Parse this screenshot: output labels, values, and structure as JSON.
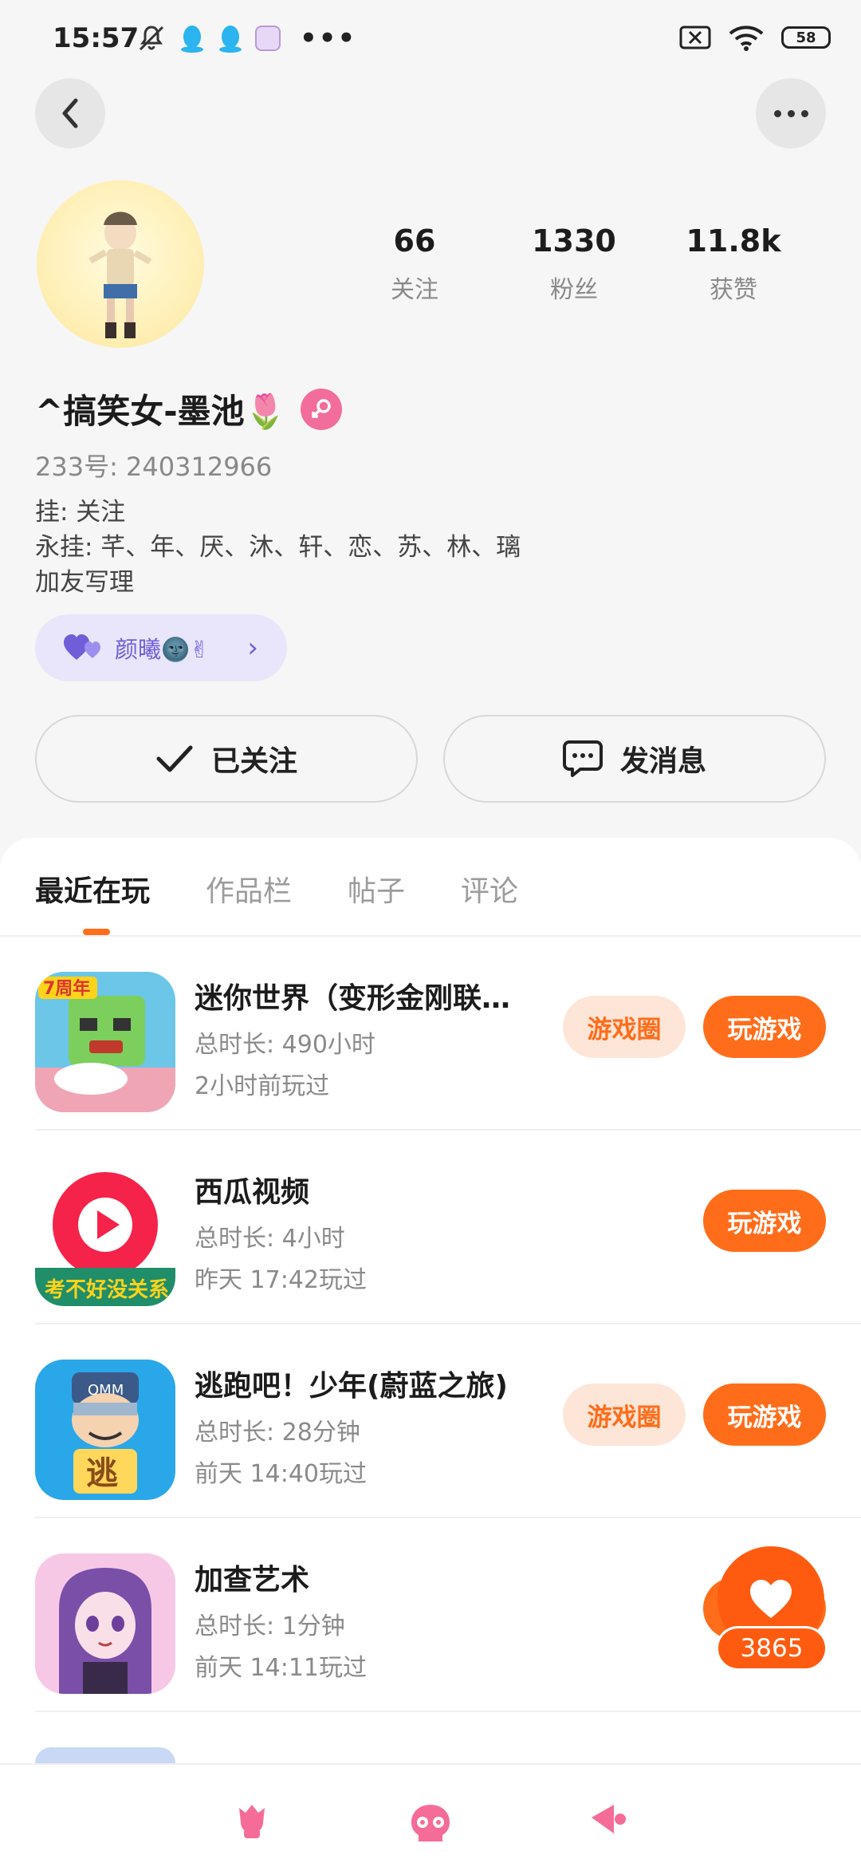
{
  "status_bar": {
    "time": "15:57",
    "battery": "58"
  },
  "profile": {
    "stats": [
      {
        "value": "66",
        "label": "关注"
      },
      {
        "value": "1330",
        "label": "粉丝"
      },
      {
        "value": "11.8k",
        "label": "获赞"
      }
    ],
    "nickname": "^搞笑女-墨池🌷",
    "uid": "233号: 240312966",
    "bio_lines": [
      "挂: 关注",
      "永挂: 芊、年、厌、沐、轩、恋、苏、林、璃",
      "加友写理"
    ],
    "fan_tag": "颜曦🌚✌"
  },
  "actions": {
    "follow_label": "已关注",
    "message_label": "发消息"
  },
  "tabs": [
    "最近在玩",
    "作品栏",
    "帖子",
    "评论"
  ],
  "games": [
    {
      "name": "迷你世界（变形金刚联…",
      "duration": "总时长: 490小时",
      "last_played": "2小时前玩过",
      "has_circle": true
    },
    {
      "name": "西瓜视频",
      "duration": "总时长: 4小时",
      "last_played": "昨天 17:42玩过",
      "has_circle": false
    },
    {
      "name": "逃跑吧！少年(蔚蓝之旅)",
      "duration": "总时长: 28分钟",
      "last_played": "前天 14:40玩过",
      "has_circle": true
    },
    {
      "name": "加查艺术",
      "duration": "总时长: 1分钟",
      "last_played": "前天 14:11玩过",
      "has_circle": false
    }
  ],
  "buttons": {
    "circle_label": "游戏圈",
    "play_label": "玩游戏"
  },
  "like_float": {
    "count": "3865"
  },
  "colors": {
    "accent": "#ff6d1b",
    "fan_tag_bg": "#e9e5fb",
    "gender": "#f26d9b",
    "nav_pink": "#f56c98"
  }
}
